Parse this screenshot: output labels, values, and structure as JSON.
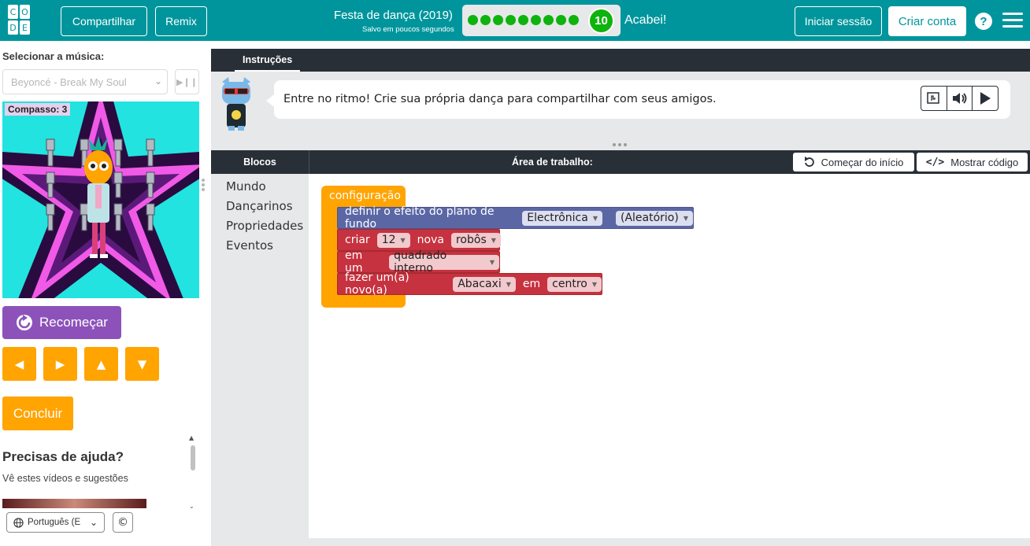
{
  "logo": {
    "letters": [
      "C",
      "O",
      "D",
      "E"
    ]
  },
  "header": {
    "share": "Compartilhar",
    "remix": "Remix",
    "title": "Festa de dança (2019)",
    "saved": "Salvo em poucos segundos",
    "level_number": "10",
    "completed_dots": 9,
    "finished": "Acabei!",
    "sign_in": "Iniciar sessão",
    "create_account": "Criar conta",
    "help": "?"
  },
  "left": {
    "music_label": "Selecionar a música:",
    "song": "Beyoncé - Break My Soul",
    "measure": "Compasso: 3",
    "restart": "Recomeçar",
    "finish": "Concluir",
    "help_title": "Precisas de ajuda?",
    "help_subtitle": "Vê estes vídeos e sugestões",
    "language": "Português (E",
    "copyright": "©"
  },
  "instructions": {
    "tab": "Instruções",
    "text": "Entre no ritmo! Crie sua própria dança para compartilhar com seus amigos."
  },
  "workspace": {
    "blocks_title": "Blocos",
    "title": "Área de trabalho:",
    "start_over": "Começar do início",
    "show_code": "Mostrar código",
    "categories": [
      "Mundo",
      "Dançarinos",
      "Propriedades",
      "Eventos"
    ]
  },
  "blocks": {
    "setup": "configuração",
    "bg": {
      "label": "definir o efeito do plano de fundo",
      "effect": "Electrônica",
      "palette": "(Aleatório)"
    },
    "create": {
      "label": "criar",
      "count": "12",
      "new": "nova",
      "dancer": "robôs"
    },
    "layout": {
      "label": "em um",
      "shape": "quadrado interno"
    },
    "make": {
      "label": "fazer um(a) novo(a)",
      "dancer": "Abacaxi",
      "at": "em",
      "location": "centro"
    }
  },
  "colors": {
    "header": "#00959c",
    "progress_green": "#0eb30e",
    "orange": "#ffa400",
    "purple_button": "#8c52ba",
    "dark_bar": "#292f36",
    "block_purple": "#5b67a5",
    "block_red": "#c6323f"
  },
  "icons": [
    "restart-icon",
    "arrow-left-icon",
    "arrow-right-icon",
    "arrow-up-icon",
    "arrow-down-icon",
    "globe-icon",
    "undo-icon",
    "code-icon",
    "play-icon",
    "speaker-icon",
    "sign-language-icon",
    "hamburger-icon"
  ]
}
